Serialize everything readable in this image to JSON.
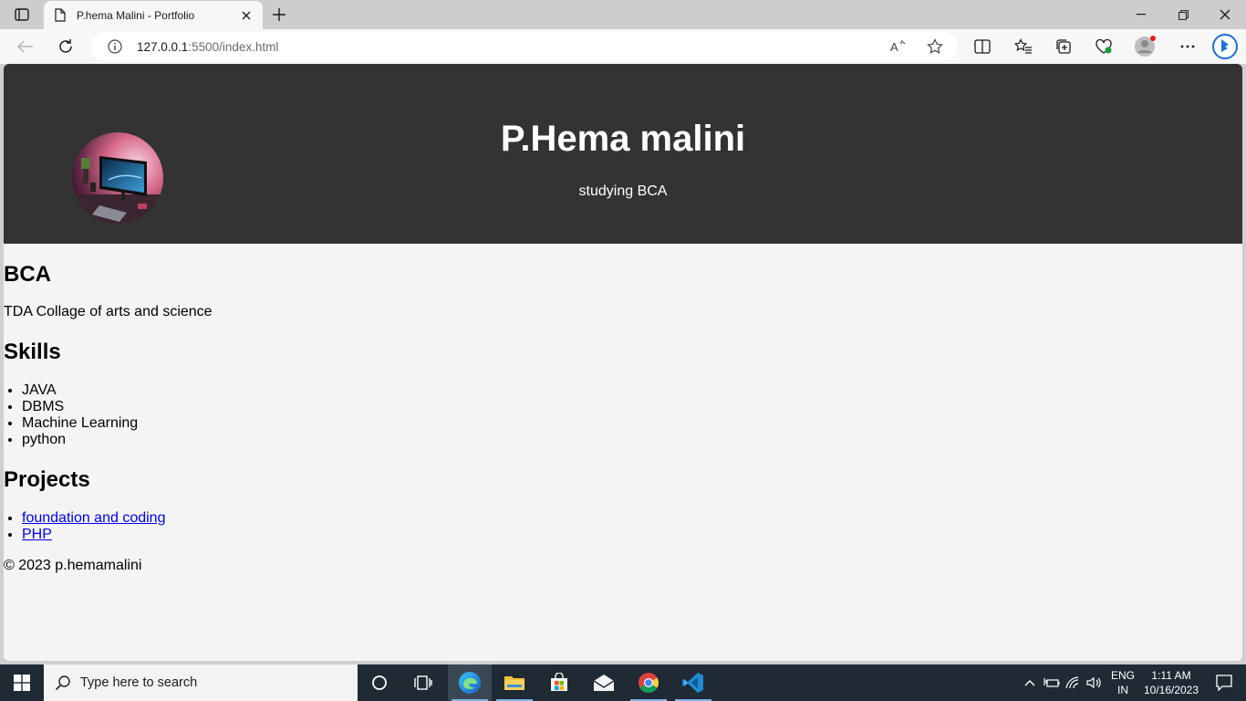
{
  "browser": {
    "tab_title": "P.hema Malini - Portfolio",
    "url_host": "127.0.0.1",
    "url_rest": ":5500/index.html"
  },
  "page": {
    "name": "P.Hema malini",
    "subtitle": "studying BCA",
    "education_heading": "BCA",
    "education_text": "TDA Collage of arts and science",
    "skills_heading": "Skills",
    "skills": [
      "JAVA",
      "DBMS",
      "Machine Learning",
      "python"
    ],
    "projects_heading": "Projects",
    "projects": [
      "foundation and coding",
      "PHP"
    ],
    "footer": "© 2023 p.hemamalini"
  },
  "taskbar": {
    "search_placeholder": "Type here to search",
    "lang_top": "ENG",
    "lang_bottom": "IN",
    "time": "1:11 AM",
    "date": "10/16/2023"
  },
  "colors": {
    "hero_bg": "#333333",
    "page_bg": "#f4f4f4",
    "link": "#0000ee",
    "taskbar": "#1f2a35"
  }
}
